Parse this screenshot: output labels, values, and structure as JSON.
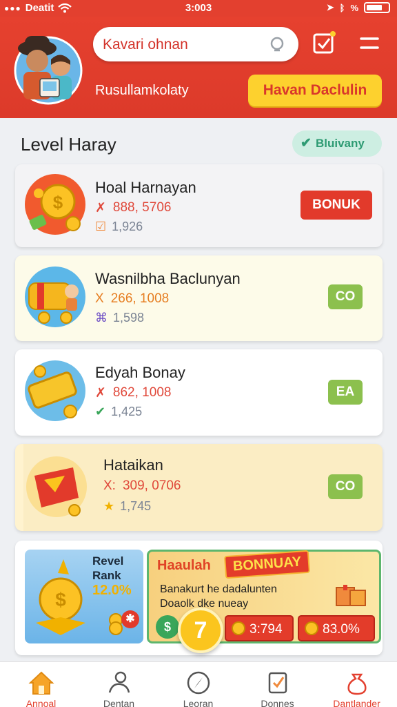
{
  "status": {
    "carrier": "Deatit",
    "time": "3:003"
  },
  "header": {
    "search_value": "Kavari ohnan",
    "subtitle": "Rusullamkolaty",
    "cta_label": "Havan Daclulin"
  },
  "level": {
    "title": "Level Haray",
    "verified_label": "Bluivany"
  },
  "cards": [
    {
      "name": "Hoal Harnayan",
      "stat1_icon": "✗",
      "stat1": "888, 5706",
      "stat2": "1,926",
      "button": "BONUK",
      "button_color": "#e23a2b"
    },
    {
      "name": "Wasnilbha Baclunyan",
      "stat1_icon": "X",
      "stat1": "266, 1008",
      "stat2": "1,598",
      "button": "CO",
      "button_color": "#8cc04e"
    },
    {
      "name": "Edyah Bonay",
      "stat1_icon": "✗",
      "stat1": "862, 1008",
      "stat2": "1,425",
      "button": "EA",
      "button_color": "#8cc04e"
    },
    {
      "name": "Hataikan",
      "stat1_icon": "X:",
      "stat1": "309, 0706",
      "stat2": "1,745",
      "button": "CO",
      "button_color": "#8cc04e"
    }
  ],
  "promo": {
    "rank_line1": "Revel",
    "rank_line2": "Rank",
    "rank_pct": "12.0%",
    "title": "Haaulah",
    "badge": "BONNUAY",
    "desc_line1": "Banakurt he dadalunten",
    "desc_line2": "Doaolk dke nueay",
    "value1": "3:794",
    "value2": "83.0%",
    "fab_label": "7"
  },
  "nav": [
    {
      "label": "Annoal"
    },
    {
      "label": "Dentan"
    },
    {
      "label": "Leoran"
    },
    {
      "label": "Donnes"
    },
    {
      "label": "Dantlander"
    }
  ],
  "colors": {
    "brand_red": "#e3402f",
    "accent_yellow": "#fdd12e",
    "success_green": "#8cc04e"
  }
}
